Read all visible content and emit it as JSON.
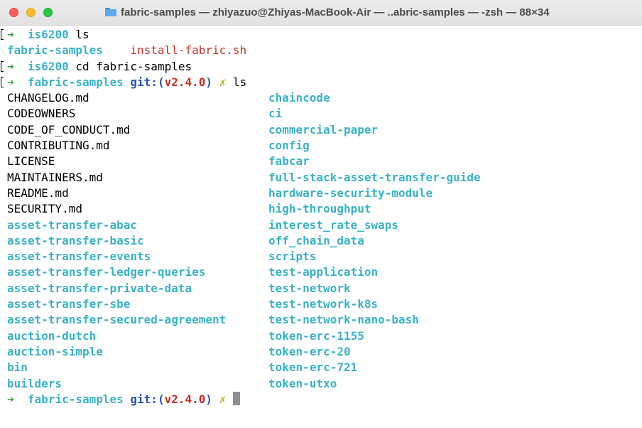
{
  "window": {
    "title": "fabric-samples — zhiyazuo@Zhiyas-MacBook-Air — ..abric-samples — -zsh — 88×34",
    "icon": "folder-icon"
  },
  "colors": {
    "prompt_arrow": "#3aa13a",
    "directory": "#3bb3c4",
    "git_label": "#2a52be",
    "branch": "#c2332b",
    "dirty_marker": "#b8b21c",
    "executable": "#c2332b"
  },
  "session": {
    "line1": {
      "arrow": "➜",
      "dir": "is6200",
      "cmd": "ls"
    },
    "line2": {
      "dir_item": "fabric-samples",
      "file_item": "install-fabric.sh"
    },
    "line3": {
      "arrow": "➜",
      "dir": "is6200",
      "cmd": "cd fabric-samples"
    },
    "line4": {
      "arrow": "➜",
      "dir": "fabric-samples",
      "git": "git:(",
      "branch": "v2.4.0",
      "git_close": ")",
      "dirty": "✗",
      "cmd": "ls"
    },
    "listing_left_files": [
      "CHANGELOG.md",
      "CODEOWNERS",
      "CODE_OF_CONDUCT.md",
      "CONTRIBUTING.md",
      "LICENSE",
      "MAINTAINERS.md",
      "README.md",
      "SECURITY.md"
    ],
    "listing_left_dirs": [
      "asset-transfer-abac",
      "asset-transfer-basic",
      "asset-transfer-events",
      "asset-transfer-ledger-queries",
      "asset-transfer-private-data",
      "asset-transfer-sbe",
      "asset-transfer-secured-agreement",
      "auction-dutch",
      "auction-simple",
      "bin",
      "builders"
    ],
    "listing_right_dirs": [
      "chaincode",
      "ci",
      "commercial-paper",
      "config",
      "fabcar",
      "full-stack-asset-transfer-guide",
      "hardware-security-module",
      "high-throughput",
      "interest_rate_swaps",
      "off_chain_data",
      "scripts",
      "test-application",
      "test-network",
      "test-network-k8s",
      "test-network-nano-bash",
      "token-erc-1155",
      "token-erc-20",
      "token-erc-721",
      "token-utxo"
    ],
    "line_final": {
      "arrow": "➜",
      "dir": "fabric-samples",
      "git": "git:(",
      "branch": "v2.4.0",
      "git_close": ")",
      "dirty": "✗"
    }
  }
}
